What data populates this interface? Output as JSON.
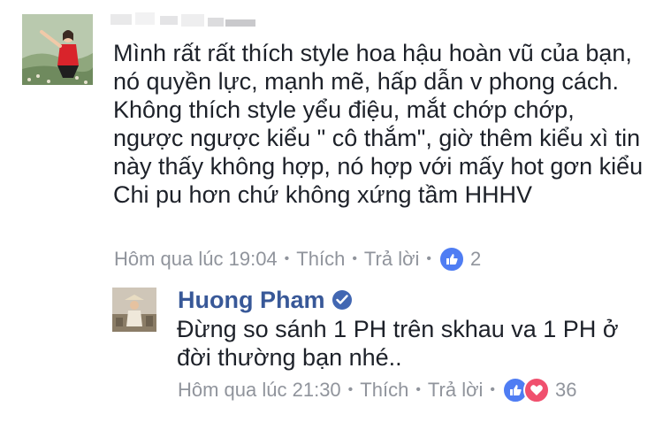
{
  "comment": {
    "author": "",
    "text": "Mình rất rất thích style hoa hậu hoàn vũ của bạn, nó quyền lực, mạnh mẽ, hấp dẫn v phong cách. Không thích style yểu điệu, mắt chớp chớp, ngược ngược kiểu \" cô thắm\", giờ thêm kiểu xì tin này thấy không hợp, nó hợp với mấy hot gơn kiểu Chi pu hơn chứ không xứng tầm HHHV",
    "timestamp": "Hôm qua lúc 19:04",
    "like_label": "Thích",
    "reply_label": "Trả lời",
    "reaction_count": "2",
    "reactions": [
      "like-icon"
    ]
  },
  "reply": {
    "author": "Huong Pham",
    "verified": true,
    "text": "Đừng so sánh 1 PH trên skhau va 1 PH ở đời thường bạn nhé..",
    "timestamp": "Hôm qua lúc 21:30",
    "like_label": "Thích",
    "reply_label": "Trả lời",
    "reaction_count": "36",
    "reactions": [
      "like-icon",
      "love-icon"
    ]
  },
  "colors": {
    "text": "#1d2129",
    "meta": "#90949c",
    "name_link": "#385898",
    "like": "#4f7df3",
    "love": "#f0506e",
    "verified": "#4267b2"
  }
}
